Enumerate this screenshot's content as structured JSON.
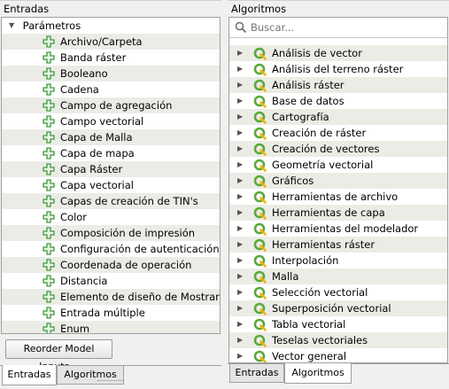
{
  "left": {
    "title": "Entradas",
    "root_label": "Parámetros",
    "params": [
      "Archivo/Carpeta",
      "Banda ráster",
      "Booleano",
      "Cadena",
      "Campo de agregación",
      "Campo vectorial",
      "Capa de Malla",
      "Capa de mapa",
      "Capa Ráster",
      "Capa vectorial",
      "Capas de creación de TIN's",
      "Color",
      "Composición de impresión",
      "Configuración de autenticación",
      "Coordenada de operación",
      "Distancia",
      "Elemento de diseño de Mostrar ...",
      "Entrada múltiple",
      "Enum"
    ],
    "reorder_button": "Reorder Model Inputs...",
    "tabs": [
      "Entradas",
      "Algoritmos"
    ]
  },
  "right": {
    "title": "Algoritmos",
    "search_placeholder": "Buscar...",
    "groups": [
      "Análisis de vector",
      "Análisis del terreno ráster",
      "Análisis ráster",
      "Base de datos",
      "Cartografía",
      "Creación de ráster",
      "Creación de vectores",
      "Geometría vectorial",
      "Gráficos",
      "Herramientas de archivo",
      "Herramientas de capa",
      "Herramientas del modelador",
      "Herramientas ráster",
      "Interpolación",
      "Malla",
      "Selección vectorial",
      "Superposición vectorial",
      "Tabla vectorial",
      "Teselas vectoriales",
      "Vector general"
    ],
    "tabs": [
      "Entradas",
      "Algoritmos"
    ]
  },
  "colors": {
    "plus_icon": "#3c9b3c",
    "q_icon": "#5aa83c",
    "row_alt": "#ecece6"
  }
}
